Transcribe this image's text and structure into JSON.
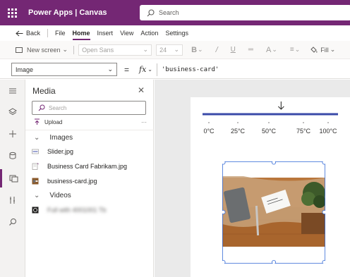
{
  "app": {
    "title": "Power Apps | Canvas",
    "search_placeholder": "Search",
    "accent": "#742774"
  },
  "menu": {
    "back": "Back",
    "items": [
      "File",
      "Home",
      "Insert",
      "View",
      "Action",
      "Settings"
    ],
    "active": "Home"
  },
  "toolbar": {
    "new_screen": "New screen",
    "font": "Open Sans",
    "font_size": "24",
    "fill": "Fill"
  },
  "formula": {
    "property": "Image",
    "equals": "=",
    "fx": "fx",
    "value": "'business-card'"
  },
  "rail": {
    "icons": [
      "hamburger-icon",
      "layers-icon",
      "plus-icon",
      "database-icon",
      "media-icon",
      "tools-icon",
      "search-icon"
    ],
    "active_index": 4
  },
  "media_panel": {
    "title": "Media",
    "search_placeholder": "Search",
    "upload_label": "Upload",
    "more": "···",
    "groups": {
      "images": {
        "label": "Images",
        "items": [
          "Slider.jpg",
          "Business Card Fabrikam.jpg",
          "business-card.jpg"
        ]
      },
      "videos": {
        "label": "Videos",
        "items": [
          "Full with 4001001 Tb"
        ]
      }
    }
  },
  "slider": {
    "ticks": [
      "0°C",
      "25°C",
      "50°C",
      "75°C",
      "100°C"
    ],
    "value_fraction": 0.58,
    "color": "#3a4aa8"
  },
  "image_control": {
    "name": "business-card"
  }
}
